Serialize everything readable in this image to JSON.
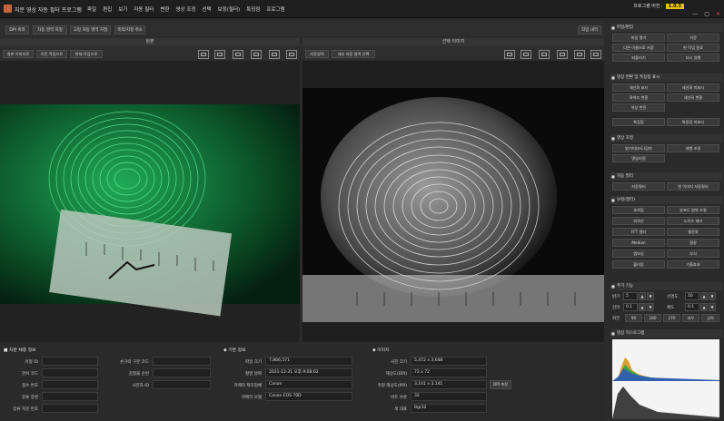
{
  "app": {
    "title": "지문 영상 자동 필터 프로그램",
    "menu": [
      "파일",
      "편집",
      "보기",
      "자동 필터",
      "변환",
      "영상 조정",
      "선택",
      "보정(필터)",
      "특징점",
      "프로그램"
    ],
    "version_label": "프로그램 버전 :",
    "version": "1.0.3"
  },
  "toolbar": {
    "dpi_save": "DPI 축적",
    "save_roi": "자동 영역 지정",
    "fixed_roi": "고정 자동 영역 지정",
    "undo_roi": "축척/지정 취소",
    "work_log": "작업 내역"
  },
  "left_panel": {
    "title": "원본",
    "buttons": [
      "원본 이미지로",
      "이전 작업으로",
      "현재 작업으로"
    ],
    "icons": [
      "crop-icon",
      "save-icon",
      "print-icon",
      "rotate-icon",
      "flip-h-icon",
      "flip-v-icon"
    ]
  },
  "right_view": {
    "title": "선택 이미지",
    "buttons": [
      "자동영역",
      "세부 자동 영역 선택"
    ],
    "icons": [
      "crop-icon",
      "save-icon",
      "print-icon",
      "rotate-icon",
      "flip-h-icon",
      "flip-v-icon"
    ]
  },
  "side": {
    "sections": {
      "file": "파일/편집",
      "transform": "영상 변환 및 특징점 표시",
      "adjust": "영상 조정",
      "auto": "자동 필터",
      "correct": "보정(필터)",
      "extra": "추가 기능",
      "hist": "영상 히스토그램"
    },
    "file_buttons": [
      "파일 열기",
      "저장",
      "다른 이름으로 저장",
      "현 작업 종료",
      "되돌리기",
      "다시 실행"
    ],
    "transform_buttons": [
      "세선화 표시",
      "세선화 미표시",
      "화색조 변환",
      "세선화 변환",
      "색상 반전",
      "특징점",
      "특징점 미표시"
    ],
    "adjust_buttons": [
      "밝기/대조도/감마",
      "레벨 조정",
      "명암지정"
    ],
    "auto_buttons": [
      "자동필터",
      "현 이미지 자동필터"
    ],
    "correct_buttons": [
      "흐려짐",
      "분포도 범위 조절",
      "외곽선",
      "노이즈 제거",
      "FFT 필터",
      "평준화",
      "Median",
      "팽창",
      "엠보싱",
      "부식",
      "블러링",
      "기울효과"
    ],
    "extra": {
      "brightness_label": "밝기",
      "brightness": "5",
      "contrast_label": "선명도",
      "contrast": "10",
      "gamma_label": "감마",
      "gamma": "0.1",
      "ratio_label": "채도",
      "ratio": "0.1",
      "rotate_label": "회전",
      "rotate_buttons": [
        "90",
        "180",
        "270",
        "좌우",
        "상하"
      ]
    }
  },
  "info": {
    "fp": {
      "title": "■ 지문 채증 정보",
      "fields": [
        "유형 ID",
        "관서 코드",
        "접수 번호",
        "증류 증명",
        "증류 지문 번호"
      ],
      "fields2": [
        "손가락 구분 코드",
        "감정물 순번",
        "사진자 ID"
      ]
    },
    "basic": {
      "title": "◆ 기본 정보",
      "labels": [
        "파일 크기",
        "촬영 날짜",
        "카메라 제조업체",
        "카메라 모델"
      ],
      "values": [
        "7,866,571",
        "2021-12-31 오후 9:08:02",
        "Canon",
        "Canon EOS 70D"
      ]
    },
    "image": {
      "title": "◆ 이미지",
      "labels": [
        "사진 크기",
        "해상도(DPI)",
        "측정 해상도(PPI)",
        "비트 수준",
        "색 대표"
      ],
      "values": [
        "5,472 x 3,648",
        "72 x 72",
        "3,141 x 3,141",
        "32",
        "Bgr32"
      ],
      "dpi_btn": "DPI 측정"
    }
  },
  "colors": {
    "accent": "#e6c200",
    "panel": "#2b2b2b",
    "green_print": "#2bd16a"
  }
}
